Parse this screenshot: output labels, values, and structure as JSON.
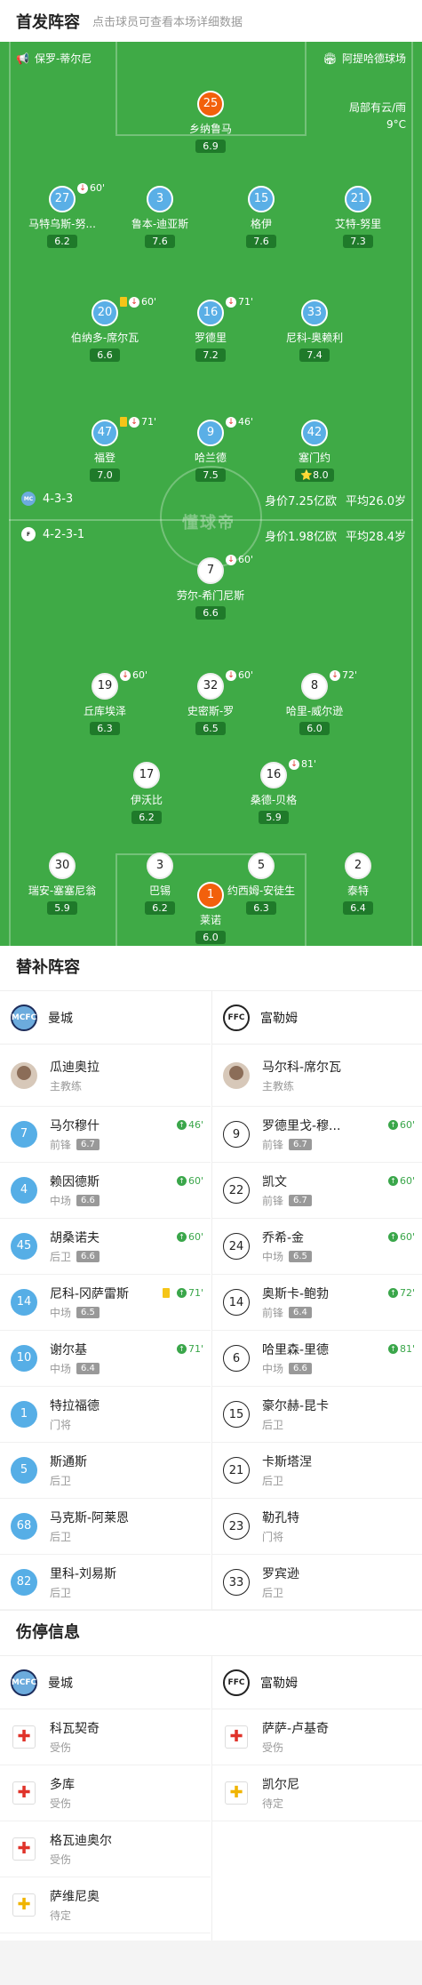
{
  "header": {
    "title": "首发阵容",
    "subtitle": "点击球员可查看本场详细数据"
  },
  "pitch": {
    "home_stadium_team": "保罗-蒂尔尼",
    "stadium": "阿提哈德球场",
    "weather": "局部有云/雨",
    "temperature": "9°C",
    "watermark": "懂球帝",
    "home_formation": "4-3-3",
    "home_value": "身价7.25亿欧",
    "home_age": "平均26.0岁",
    "away_formation": "4-2-3-1",
    "away_value": "身价1.98亿欧",
    "away_age": "平均28.4岁"
  },
  "home_players": [
    {
      "num": "25",
      "name": "乡纳鲁马",
      "rating": "6.9"
    },
    {
      "num": "27",
      "name": "马特乌斯-努...",
      "rating": "6.2",
      "sub": "60'"
    },
    {
      "num": "3",
      "name": "鲁本-迪亚斯",
      "rating": "7.6"
    },
    {
      "num": "15",
      "name": "格伊",
      "rating": "7.6"
    },
    {
      "num": "21",
      "name": "艾特-努里",
      "rating": "7.3"
    },
    {
      "num": "20",
      "name": "伯纳多-席尔瓦",
      "rating": "6.6",
      "sub": "60'"
    },
    {
      "num": "16",
      "name": "罗德里",
      "rating": "7.2",
      "sub": "71'"
    },
    {
      "num": "33",
      "name": "尼科-奥赖利",
      "rating": "7.4"
    },
    {
      "num": "47",
      "name": "福登",
      "rating": "7.0",
      "sub": "71'"
    },
    {
      "num": "9",
      "name": "哈兰德",
      "rating": "7.5",
      "sub": "46'"
    },
    {
      "num": "42",
      "name": "塞门约",
      "rating": "8.0"
    }
  ],
  "away_players": [
    {
      "num": "7",
      "name": "劳尔-希门尼斯",
      "rating": "6.6",
      "sub": "60'"
    },
    {
      "num": "19",
      "name": "丘库埃泽",
      "rating": "6.3",
      "sub": "60'"
    },
    {
      "num": "32",
      "name": "史密斯-罗",
      "rating": "6.5",
      "sub": "60'"
    },
    {
      "num": "8",
      "name": "哈里-威尔逊",
      "rating": "6.0",
      "sub": "72'"
    },
    {
      "num": "17",
      "name": "伊沃比",
      "rating": "6.2"
    },
    {
      "num": "16",
      "name": "桑德-贝格",
      "rating": "5.9",
      "sub": "81'"
    },
    {
      "num": "30",
      "name": "瑞安-塞塞尼翁",
      "rating": "5.9"
    },
    {
      "num": "3",
      "name": "巴锡",
      "rating": "6.2"
    },
    {
      "num": "5",
      "name": "约西姆-安徒生",
      "rating": "6.3"
    },
    {
      "num": "2",
      "name": "泰特",
      "rating": "6.4"
    },
    {
      "num": "1",
      "name": "莱诺",
      "rating": "6.0"
    }
  ],
  "subs": {
    "title": "替补阵容",
    "home_team": "曼城",
    "away_team": "富勒姆",
    "home_coach": {
      "name": "瓜迪奥拉",
      "role": "主教练"
    },
    "away_coach": {
      "name": "马尔科-席尔瓦",
      "role": "主教练"
    },
    "home": [
      {
        "num": "7",
        "name": "马尔穆什",
        "pos": "前锋",
        "rating": "6.7",
        "min": "46'"
      },
      {
        "num": "4",
        "name": "赖因德斯",
        "pos": "中场",
        "rating": "6.6",
        "min": "60'"
      },
      {
        "num": "45",
        "name": "胡桑诺夫",
        "pos": "后卫",
        "rating": "6.6",
        "min": "60'"
      },
      {
        "num": "14",
        "name": "尼科-冈萨雷斯",
        "pos": "中场",
        "rating": "6.5",
        "min": "71'"
      },
      {
        "num": "10",
        "name": "谢尔基",
        "pos": "中场",
        "rating": "6.4",
        "min": "71'"
      },
      {
        "num": "1",
        "name": "特拉福德",
        "pos": "门将"
      },
      {
        "num": "5",
        "name": "斯通斯",
        "pos": "后卫"
      },
      {
        "num": "68",
        "name": "马克斯-阿莱恩",
        "pos": "后卫"
      },
      {
        "num": "82",
        "name": "里科-刘易斯",
        "pos": "后卫"
      }
    ],
    "away": [
      {
        "num": "9",
        "name": "罗德里戈-穆...",
        "pos": "前锋",
        "rating": "6.7",
        "min": "60'"
      },
      {
        "num": "22",
        "name": "凯文",
        "pos": "前锋",
        "rating": "6.7",
        "min": "60'"
      },
      {
        "num": "24",
        "name": "乔希-金",
        "pos": "中场",
        "rating": "6.5",
        "min": "60'"
      },
      {
        "num": "14",
        "name": "奥斯卡-鲍勃",
        "pos": "前锋",
        "rating": "6.4",
        "min": "72'"
      },
      {
        "num": "6",
        "name": "哈里森-里德",
        "pos": "中场",
        "rating": "6.6",
        "min": "81'"
      },
      {
        "num": "15",
        "name": "豪尔赫-昆卡",
        "pos": "后卫"
      },
      {
        "num": "21",
        "name": "卡斯塔涅",
        "pos": "后卫"
      },
      {
        "num": "23",
        "name": "勒孔特",
        "pos": "门将"
      },
      {
        "num": "33",
        "name": "罗宾逊",
        "pos": "后卫"
      }
    ]
  },
  "injuries": {
    "title": "伤停信息",
    "home_team": "曼城",
    "away_team": "富勒姆",
    "home": [
      {
        "name": "科瓦契奇",
        "status": "受伤",
        "icon": "red-cross"
      },
      {
        "name": "多库",
        "status": "受伤",
        "icon": "red-cross"
      },
      {
        "name": "格瓦迪奥尔",
        "status": "受伤",
        "icon": "red-cross"
      },
      {
        "name": "萨维尼奥",
        "status": "待定",
        "icon": "yellow-cross"
      }
    ],
    "away": [
      {
        "name": "萨萨-卢基奇",
        "status": "受伤",
        "icon": "red-cross"
      },
      {
        "name": "凯尔尼",
        "status": "待定",
        "icon": "yellow-cross"
      }
    ]
  }
}
